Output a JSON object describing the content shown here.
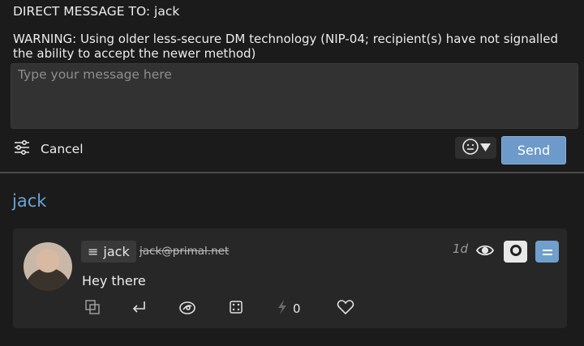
{
  "compose": {
    "header": "DIRECT MESSAGE TO: jack",
    "warning": "WARNING: Using older less-secure DM technology (NIP-04; recipient(s) have not signalled the ability to accept the newer method)",
    "placeholder": "Type your message here",
    "cancel_label": "Cancel",
    "emoji_picker": "😐▼",
    "send_label": "Send"
  },
  "thread": {
    "title": "jack",
    "message": {
      "author_name": "jack",
      "author_chip_icon": "≡",
      "nip05": "jack@primal.net",
      "time_ago": "1d",
      "content": "Hey there",
      "zap_count": "0"
    }
  },
  "colors": {
    "accent": "#6d9ac8",
    "title_blue": "#6aa4d4",
    "background": "#1b1b1b",
    "panel": "#272727"
  },
  "icons": [
    "sliders-icon",
    "emoji-icon",
    "eye-icon",
    "record-icon",
    "menu-icon",
    "copy-icon",
    "reply-icon",
    "repost-icon",
    "dice-icon",
    "zap-icon",
    "heart-icon"
  ]
}
